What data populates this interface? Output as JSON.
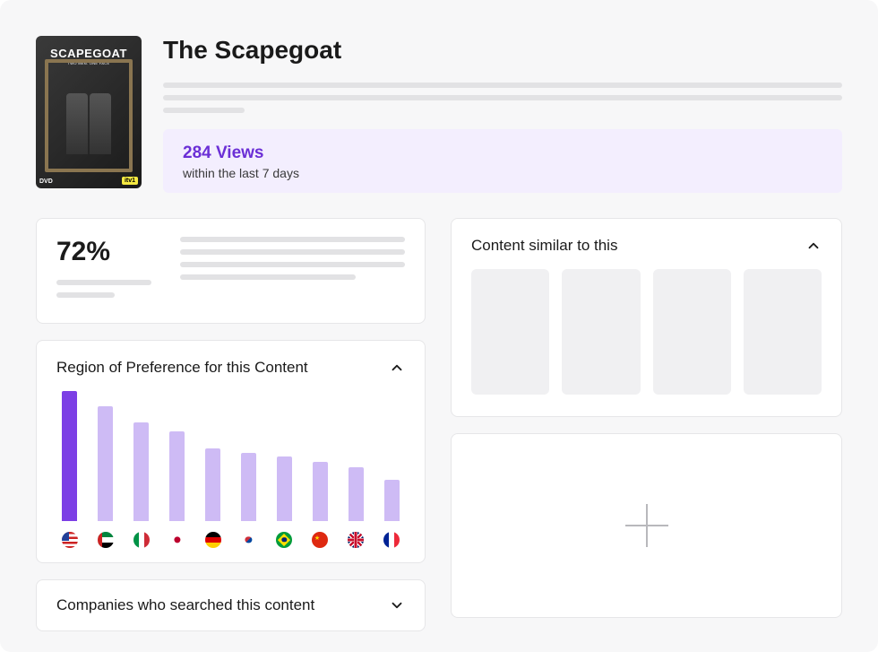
{
  "header": {
    "title": "The Scapegoat",
    "poster": {
      "title": "SCAPEGOAT",
      "subtitle": "TWO MEN. ONE FACE",
      "dvd_label": "DVD",
      "broadcaster": "itv1"
    }
  },
  "views": {
    "count": "284 Views",
    "period": "within the last 7 days"
  },
  "stats": {
    "percent": "72%"
  },
  "region": {
    "title": "Region of Preference for this Content",
    "expanded": true
  },
  "chart_data": {
    "type": "bar",
    "title": "Region of Preference for this Content",
    "xlabel": "",
    "ylabel": "",
    "ylim": [
      0,
      145
    ],
    "categories": [
      "US",
      "AE",
      "IT",
      "JP",
      "DE",
      "KR",
      "BR",
      "CN",
      "GB",
      "FR"
    ],
    "values": [
      145,
      128,
      110,
      100,
      81,
      76,
      72,
      66,
      60,
      46
    ],
    "highlighted_index": 0
  },
  "companies": {
    "title": "Companies who searched this content",
    "expanded": false
  },
  "similar": {
    "title": "Content similar to this",
    "expanded": true
  }
}
